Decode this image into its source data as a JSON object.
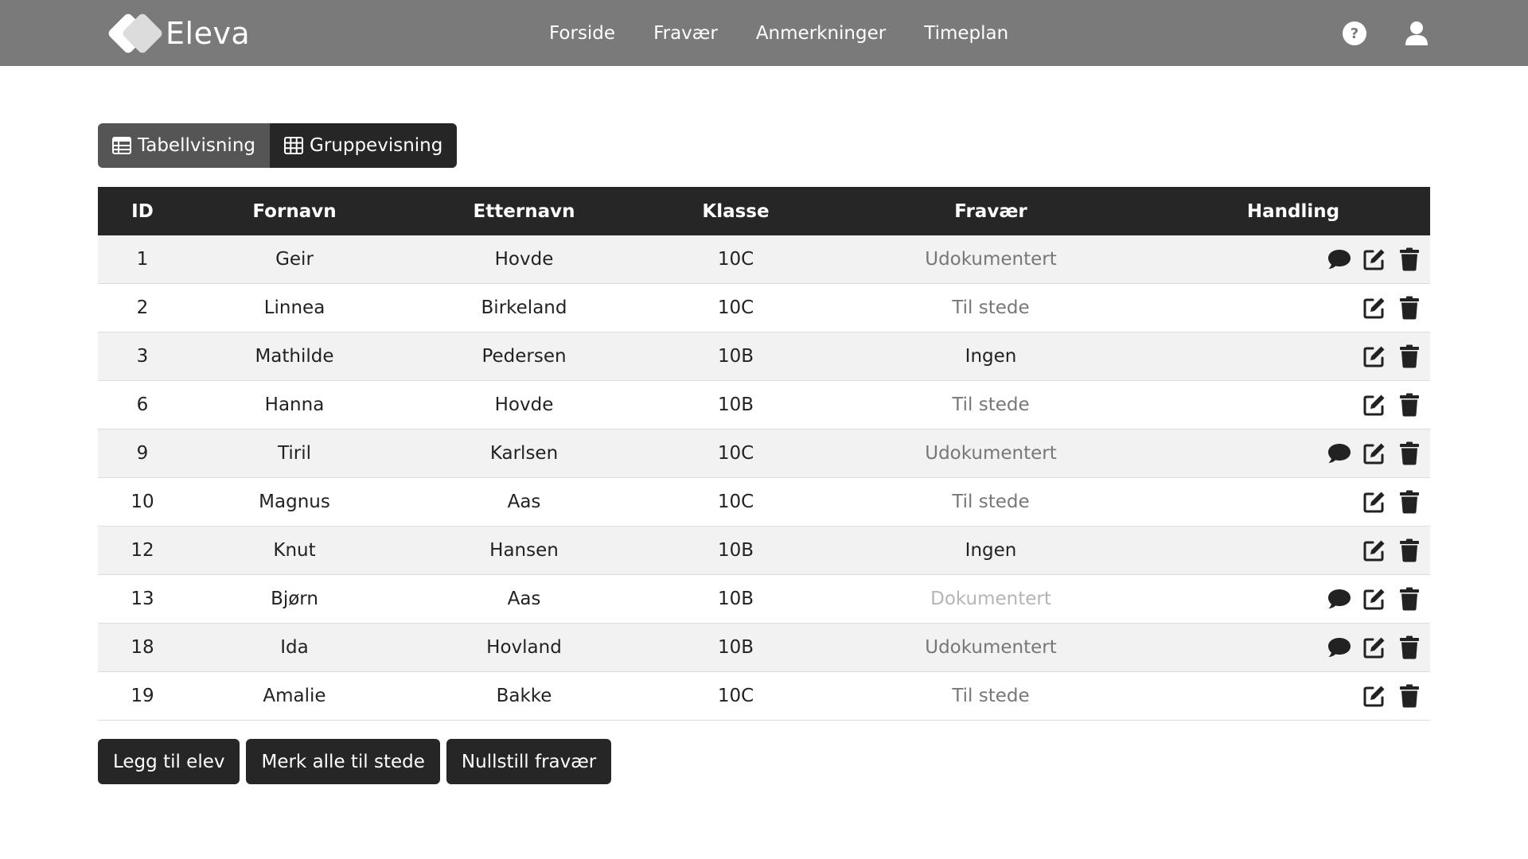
{
  "brand": {
    "name": "Eleva"
  },
  "nav": {
    "links": [
      "Forside",
      "Fravær",
      "Anmerkninger",
      "Timeplan"
    ],
    "icons": [
      "help-icon",
      "user-icon"
    ]
  },
  "view_toggle": {
    "table_label": "Tabellvisning",
    "group_label": "Gruppevisning",
    "active": "table"
  },
  "table": {
    "headers": [
      "ID",
      "Fornavn",
      "Etternavn",
      "Klasse",
      "Fravær",
      "Handling"
    ],
    "rows": [
      {
        "id": "1",
        "first": "Geir",
        "last": "Hovde",
        "class": "10C",
        "absence": "Udokumentert",
        "comment": true
      },
      {
        "id": "2",
        "first": "Linnea",
        "last": "Birkeland",
        "class": "10C",
        "absence": "Til stede",
        "comment": false
      },
      {
        "id": "3",
        "first": "Mathilde",
        "last": "Pedersen",
        "class": "10B",
        "absence": "Ingen",
        "comment": false
      },
      {
        "id": "6",
        "first": "Hanna",
        "last": "Hovde",
        "class": "10B",
        "absence": "Til stede",
        "comment": false
      },
      {
        "id": "9",
        "first": "Tiril",
        "last": "Karlsen",
        "class": "10C",
        "absence": "Udokumentert",
        "comment": true
      },
      {
        "id": "10",
        "first": "Magnus",
        "last": "Aas",
        "class": "10C",
        "absence": "Til stede",
        "comment": false
      },
      {
        "id": "12",
        "first": "Knut",
        "last": "Hansen",
        "class": "10B",
        "absence": "Ingen",
        "comment": false
      },
      {
        "id": "13",
        "first": "Bjørn",
        "last": "Aas",
        "class": "10B",
        "absence": "Dokumentert",
        "comment": true
      },
      {
        "id": "18",
        "first": "Ida",
        "last": "Hovland",
        "class": "10B",
        "absence": "Udokumentert",
        "comment": true
      },
      {
        "id": "19",
        "first": "Amalie",
        "last": "Bakke",
        "class": "10C",
        "absence": "Til stede",
        "comment": false
      }
    ],
    "action_icons": [
      "comment-icon",
      "edit-icon",
      "trash-icon"
    ]
  },
  "buttons": {
    "add_student": "Legg til elev",
    "mark_all_present": "Merk alle til stede",
    "reset_absence": "Nullstill fravær"
  },
  "colors": {
    "navbar": "#7a7a7a",
    "dark": "#262626",
    "active_toggle": "#555555",
    "row_stripe": "#f2f2f2"
  }
}
